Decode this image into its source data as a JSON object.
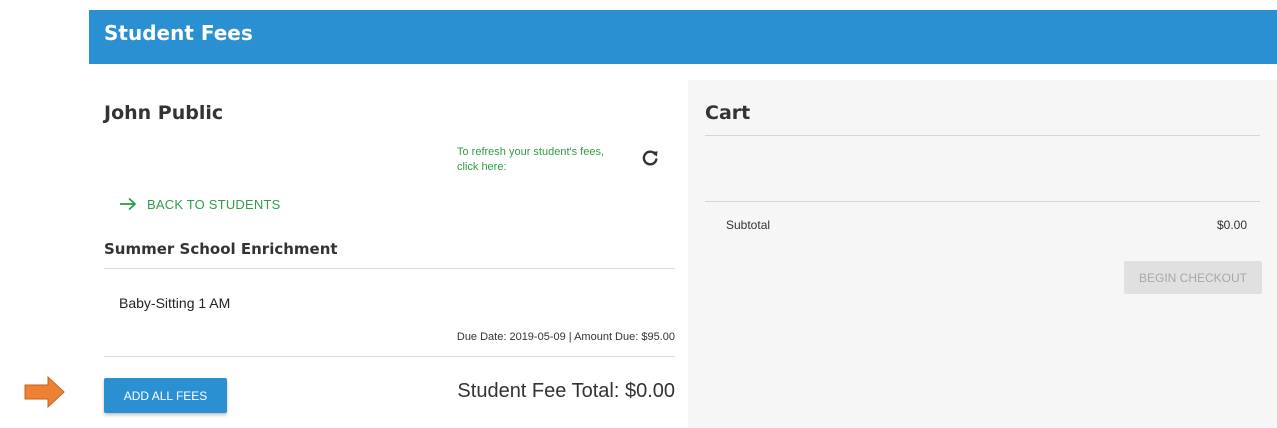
{
  "header": {
    "title": "Student Fees"
  },
  "student": {
    "name": "John Public",
    "refresh_text": "To refresh your student's fees, click here:",
    "back_link_label": "BACK TO STUDENTS"
  },
  "program": {
    "title": "Summer School Enrichment",
    "fees": [
      {
        "name": "Baby-Sitting 1 AM",
        "meta": "Due Date: 2019-05-09 | Amount Due: $95.00"
      }
    ]
  },
  "actions": {
    "add_all_label": "ADD ALL FEES",
    "fee_total": "Student Fee Total: $0.00"
  },
  "cart": {
    "title": "Cart",
    "subtotal_label": "Subtotal",
    "subtotal_value": "$0.00",
    "checkout_label": "BEGIN CHECKOUT"
  },
  "icons": {
    "refresh": "refresh-icon",
    "back": "arrow-right-icon",
    "pointer": "orange-arrow-icon"
  },
  "colors": {
    "accent": "#2a90d2",
    "link_green": "#2e9e47",
    "pointer_orange": "#ee8234",
    "cart_bg": "#f6f6f6",
    "disabled_bg": "#e0e0e0"
  }
}
